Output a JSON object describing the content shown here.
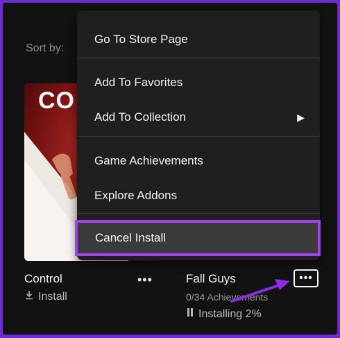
{
  "library": {
    "sort_label": "Sort by:",
    "cards": [
      {
        "title": "Control",
        "action": "Install",
        "cover_text": "CO"
      },
      {
        "title": "Fall Guys",
        "achievements": "0/34 Achievements",
        "status": "Installing 2%"
      }
    ],
    "more_glyph": "•••"
  },
  "context_menu": {
    "items": [
      "Go To Store Page",
      "Add To Favorites",
      "Add To Collection",
      "Game Achievements",
      "Explore Addons",
      "Cancel Install"
    ],
    "submenu_glyph": "▶"
  },
  "colors": {
    "frame": "#6a2cd0",
    "background": "#121212",
    "menu_bg": "#1f1f1f",
    "highlight_border": "#a43ff0",
    "arrow": "#8b2be2"
  }
}
